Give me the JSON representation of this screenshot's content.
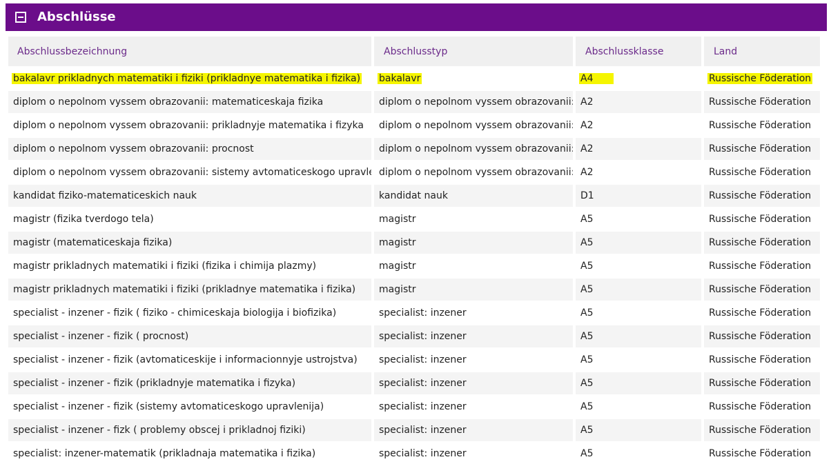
{
  "panel": {
    "title": "Abschlüsse",
    "header_color": "#6b0d8a",
    "toggle_icon": "collapse-minus-icon"
  },
  "table": {
    "columns": [
      "Abschlussbezeichnung",
      "Abschlusstyp",
      "Abschlussklasse",
      "Land"
    ],
    "highlight_color": "#f5f500",
    "rows": [
      {
        "bezeichnung": "bakalavr prikladnych matematiki i fiziki (prikladnye matematika i fizika)",
        "typ": "bakalavr",
        "klasse": "A4",
        "land": "Russische Föderation",
        "highlighted": true
      },
      {
        "bezeichnung": "diplom o nepolnom vyssem obrazovanii: matematiceskaja fizika",
        "typ": "diplom o nepolnom vyssem obrazovanii:",
        "klasse": "A2",
        "land": "Russische Föderation"
      },
      {
        "bezeichnung": "diplom o nepolnom vyssem obrazovanii: prikladnyje matematika i fizyka",
        "typ": "diplom o nepolnom vyssem obrazovanii:",
        "klasse": "A2",
        "land": "Russische Föderation"
      },
      {
        "bezeichnung": "diplom o nepolnom vyssem obrazovanii: procnost",
        "typ": "diplom o nepolnom vyssem obrazovanii:",
        "klasse": "A2",
        "land": "Russische Föderation"
      },
      {
        "bezeichnung": "diplom o nepolnom vyssem obrazovanii: sistemy avtomaticeskogo upravlenija",
        "typ": "diplom o nepolnom vyssem obrazovanii:",
        "klasse": "A2",
        "land": "Russische Föderation"
      },
      {
        "bezeichnung": "kandidat fiziko-matematiceskich nauk",
        "typ": "kandidat nauk",
        "klasse": "D1",
        "land": "Russische Föderation"
      },
      {
        "bezeichnung": "magistr (fizika tverdogo tela)",
        "typ": "magistr",
        "klasse": "A5",
        "land": "Russische Föderation"
      },
      {
        "bezeichnung": "magistr (matematiceskaja fizika)",
        "typ": "magistr",
        "klasse": "A5",
        "land": "Russische Föderation"
      },
      {
        "bezeichnung": "magistr prikladnych matematiki i fiziki (fizika i chimija plazmy)",
        "typ": "magistr",
        "klasse": "A5",
        "land": "Russische Föderation"
      },
      {
        "bezeichnung": "magistr prikladnych matematiki i fiziki (prikladnye matematika i fizika)",
        "typ": "magistr",
        "klasse": "A5",
        "land": "Russische Föderation"
      },
      {
        "bezeichnung": "specialist - inzener - fizik ( fiziko - chimiceskaja biologija i biofizika)",
        "typ": "specialist: inzener",
        "klasse": "A5",
        "land": "Russische Föderation"
      },
      {
        "bezeichnung": "specialist - inzener - fizik ( procnost)",
        "typ": "specialist: inzener",
        "klasse": "A5",
        "land": "Russische Föderation"
      },
      {
        "bezeichnung": "specialist - inzener - fizik (avtomaticeskije i informacionnyje ustrojstva)",
        "typ": "specialist: inzener",
        "klasse": "A5",
        "land": "Russische Föderation"
      },
      {
        "bezeichnung": "specialist - inzener - fizik (prikladnyje matematika i fizyka)",
        "typ": "specialist: inzener",
        "klasse": "A5",
        "land": "Russische Föderation"
      },
      {
        "bezeichnung": "specialist - inzener - fizik (sistemy avtomaticeskogo upravlenija)",
        "typ": "specialist: inzener",
        "klasse": "A5",
        "land": "Russische Föderation"
      },
      {
        "bezeichnung": "specialist - inzener - fizk ( problemy obscej i prikladnoj fiziki)",
        "typ": "specialist: inzener",
        "klasse": "A5",
        "land": "Russische Föderation"
      },
      {
        "bezeichnung": "specialist: inzener-matematik (prikladnaja matematika i fizika)",
        "typ": "specialist: inzener",
        "klasse": "A5",
        "land": "Russische Föderation"
      }
    ]
  }
}
